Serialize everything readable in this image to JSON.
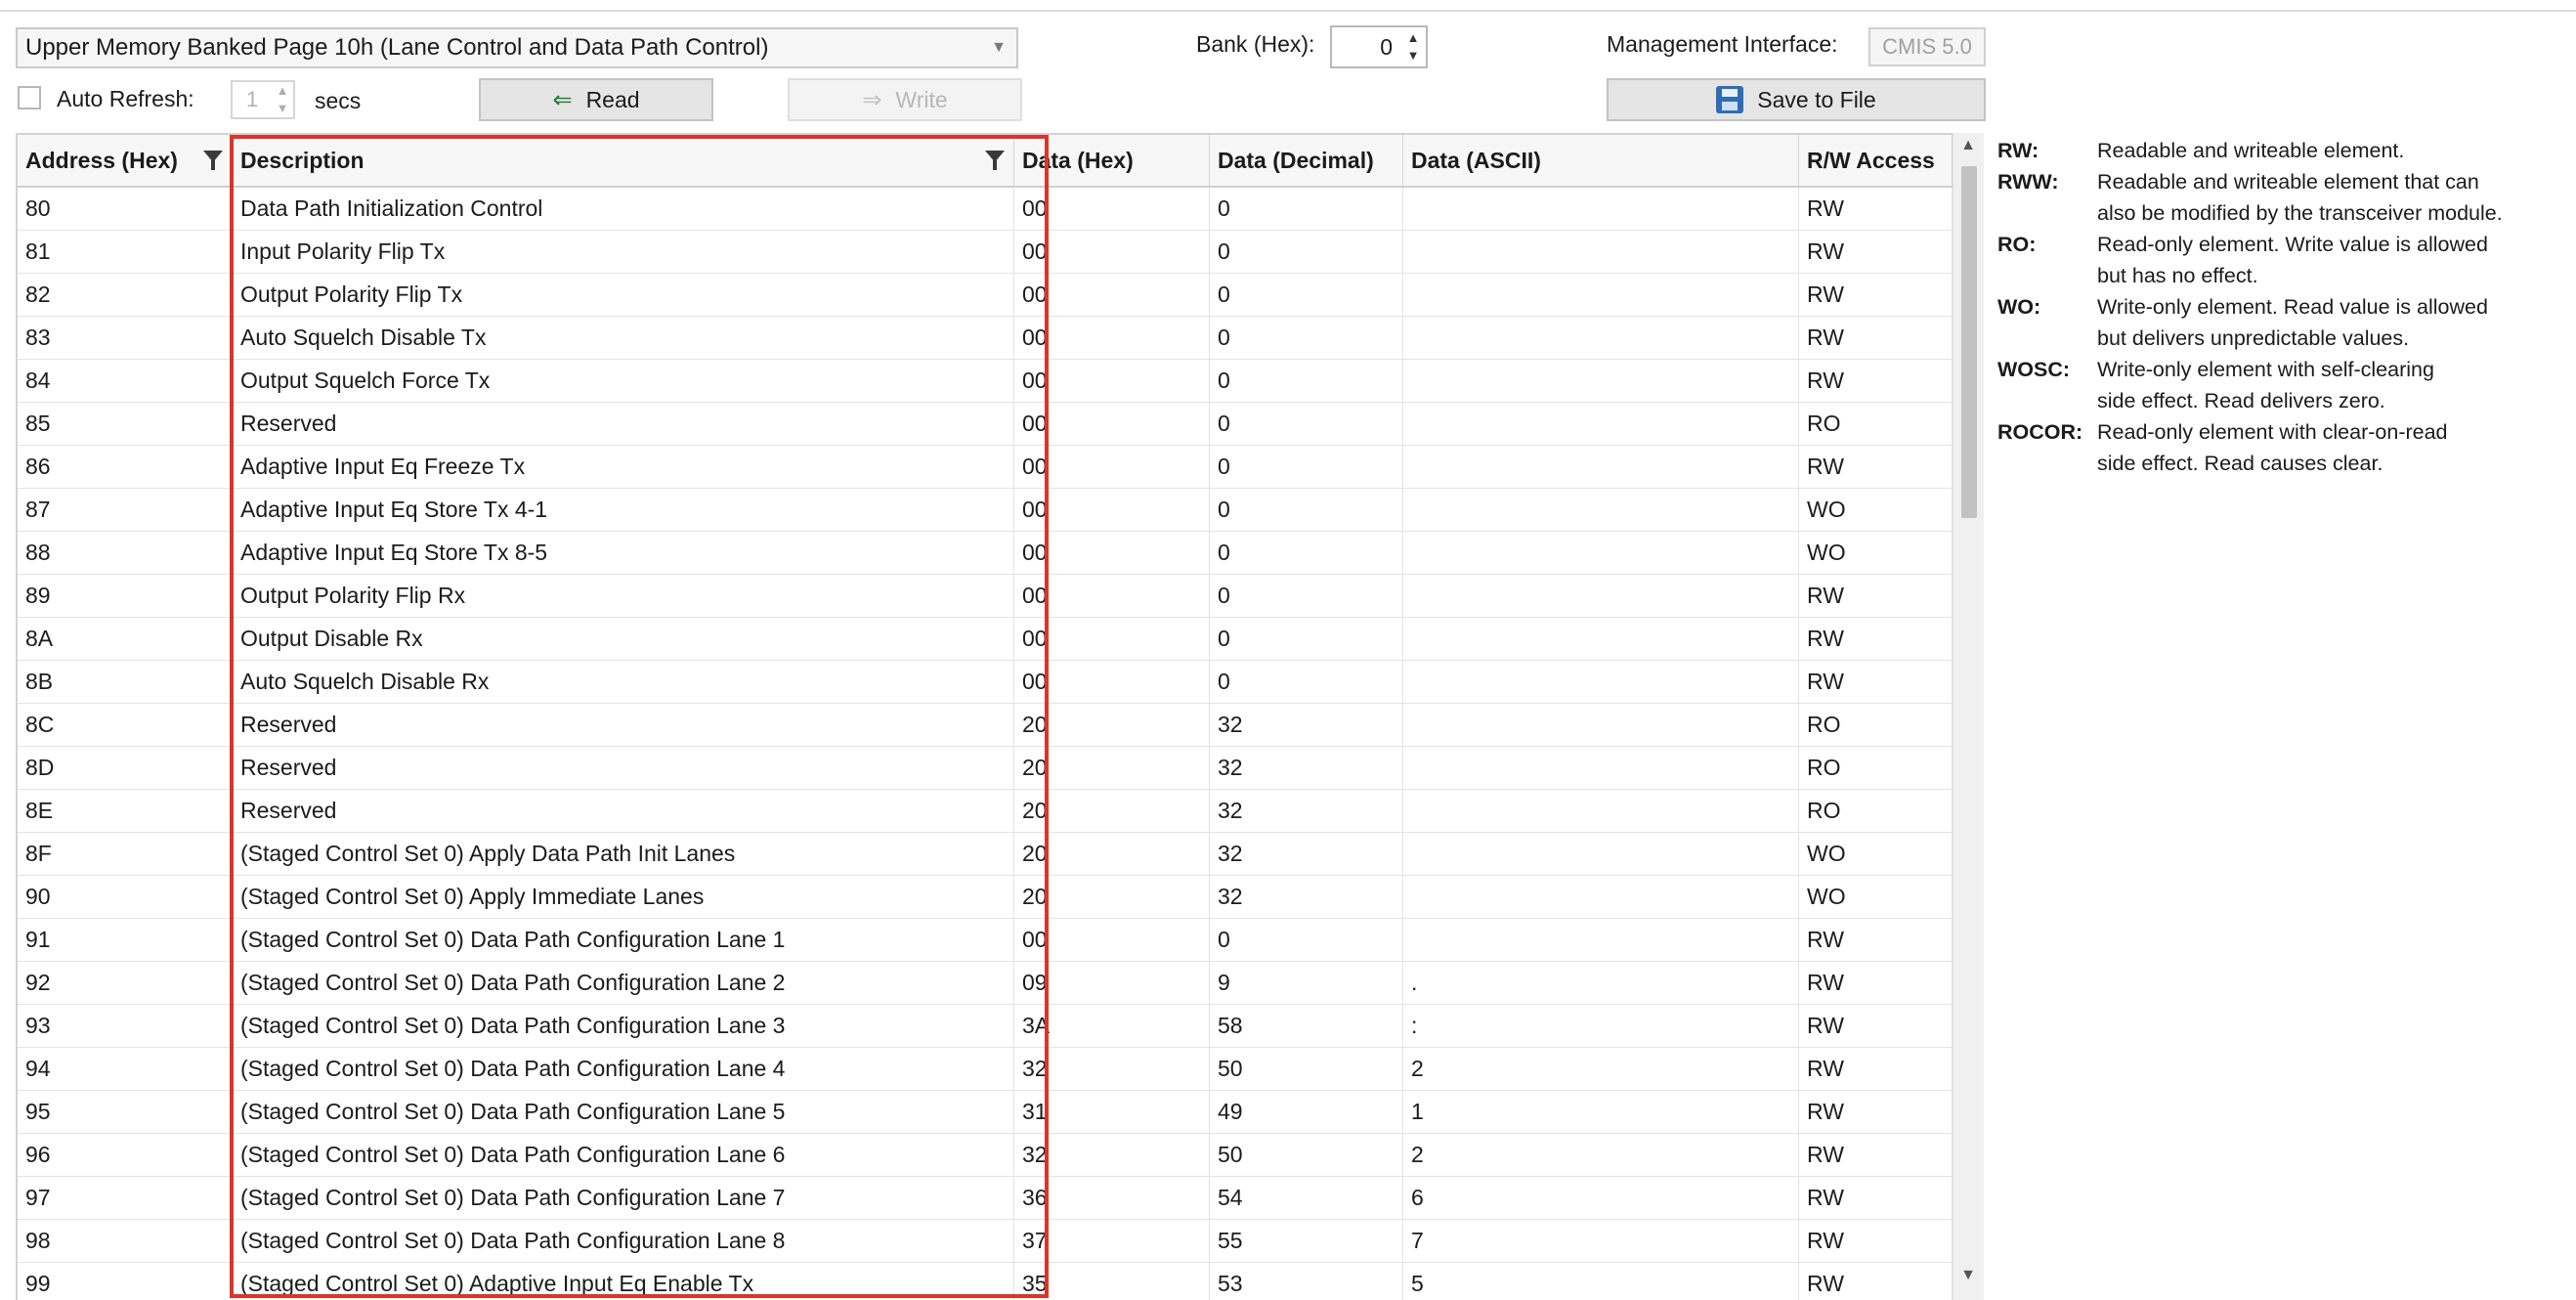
{
  "page_selector": {
    "value": "Upper Memory Banked Page 10h (Lane Control and Data Path Control)"
  },
  "bank": {
    "label": "Bank (Hex):",
    "value": "0"
  },
  "management": {
    "label": "Management Interface:",
    "value": "CMIS 5.0"
  },
  "auto_refresh": {
    "label": "Auto Refresh:",
    "value": "1",
    "unit": "secs",
    "checked": false
  },
  "buttons": {
    "read": "Read",
    "write": "Write",
    "save": "Save to File"
  },
  "table": {
    "headers": [
      "Address (Hex)",
      "Description",
      "Data (Hex)",
      "Data (Decimal)",
      "Data (ASCII)",
      "R/W Access"
    ],
    "rows": [
      [
        "80",
        "Data Path Initialization Control",
        "00",
        "0",
        "",
        "RW"
      ],
      [
        "81",
        "Input Polarity Flip Tx",
        "00",
        "0",
        "",
        "RW"
      ],
      [
        "82",
        "Output Polarity Flip Tx",
        "00",
        "0",
        "",
        "RW"
      ],
      [
        "83",
        "Auto Squelch Disable Tx",
        "00",
        "0",
        "",
        "RW"
      ],
      [
        "84",
        "Output Squelch Force Tx",
        "00",
        "0",
        "",
        "RW"
      ],
      [
        "85",
        "Reserved",
        "00",
        "0",
        "",
        "RO"
      ],
      [
        "86",
        "Adaptive Input Eq Freeze Tx",
        "00",
        "0",
        "",
        "RW"
      ],
      [
        "87",
        "Adaptive Input Eq Store Tx 4-1",
        "00",
        "0",
        "",
        "WO"
      ],
      [
        "88",
        "Adaptive Input Eq Store Tx 8-5",
        "00",
        "0",
        "",
        "WO"
      ],
      [
        "89",
        "Output Polarity Flip Rx",
        "00",
        "0",
        "",
        "RW"
      ],
      [
        "8A",
        "Output Disable Rx",
        "00",
        "0",
        "",
        "RW"
      ],
      [
        "8B",
        "Auto Squelch Disable Rx",
        "00",
        "0",
        "",
        "RW"
      ],
      [
        "8C",
        "Reserved",
        "20",
        "32",
        "",
        "RO"
      ],
      [
        "8D",
        "Reserved",
        "20",
        "32",
        "",
        "RO"
      ],
      [
        "8E",
        "Reserved",
        "20",
        "32",
        "",
        "RO"
      ],
      [
        "8F",
        "(Staged Control Set 0) Apply Data Path Init Lanes",
        "20",
        "32",
        "",
        "WO"
      ],
      [
        "90",
        "(Staged Control Set 0) Apply Immediate Lanes",
        "20",
        "32",
        "",
        "WO"
      ],
      [
        "91",
        "(Staged Control Set 0) Data Path Configuration Lane 1",
        "00",
        "0",
        "",
        "RW"
      ],
      [
        "92",
        "(Staged Control Set 0) Data Path Configuration Lane 2",
        "09",
        "9",
        ".",
        "RW"
      ],
      [
        "93",
        "(Staged Control Set 0) Data Path Configuration Lane 3",
        "3A",
        "58",
        ":",
        "RW"
      ],
      [
        "94",
        "(Staged Control Set 0) Data Path Configuration Lane 4",
        "32",
        "50",
        "2",
        "RW"
      ],
      [
        "95",
        "(Staged Control Set 0) Data Path Configuration Lane 5",
        "31",
        "49",
        "1",
        "RW"
      ],
      [
        "96",
        "(Staged Control Set 0) Data Path Configuration Lane 6",
        "32",
        "50",
        "2",
        "RW"
      ],
      [
        "97",
        "(Staged Control Set 0) Data Path Configuration Lane 7",
        "36",
        "54",
        "6",
        "RW"
      ],
      [
        "98",
        "(Staged Control Set 0) Data Path Configuration Lane 8",
        "37",
        "55",
        "7",
        "RW"
      ],
      [
        "99",
        "(Staged Control Set 0) Adaptive Input Eq Enable Tx",
        "35",
        "53",
        "5",
        "RW"
      ]
    ]
  },
  "legend": [
    {
      "key": "RW:",
      "lines": [
        "Readable and writeable element."
      ]
    },
    {
      "key": "RWW:",
      "lines": [
        "Readable and writeable element that can",
        "also be modified by the transceiver module."
      ]
    },
    {
      "key": "RO:",
      "lines": [
        "Read-only element. Write value is allowed",
        "but has no effect."
      ]
    },
    {
      "key": "WO:",
      "lines": [
        "Write-only element. Read value is allowed",
        "but delivers unpredictable values."
      ]
    },
    {
      "key": "WOSC:",
      "lines": [
        "Write-only element with self-clearing",
        "side effect. Read delivers zero."
      ]
    },
    {
      "key": "ROCOR:",
      "lines": [
        "Read-only element with clear-on-read",
        "side effect. Read causes clear."
      ]
    }
  ],
  "colors": {
    "highlight": "#d9362b",
    "accent_arrow": "#1a7d2e",
    "save_icon": "#2e6db4"
  }
}
